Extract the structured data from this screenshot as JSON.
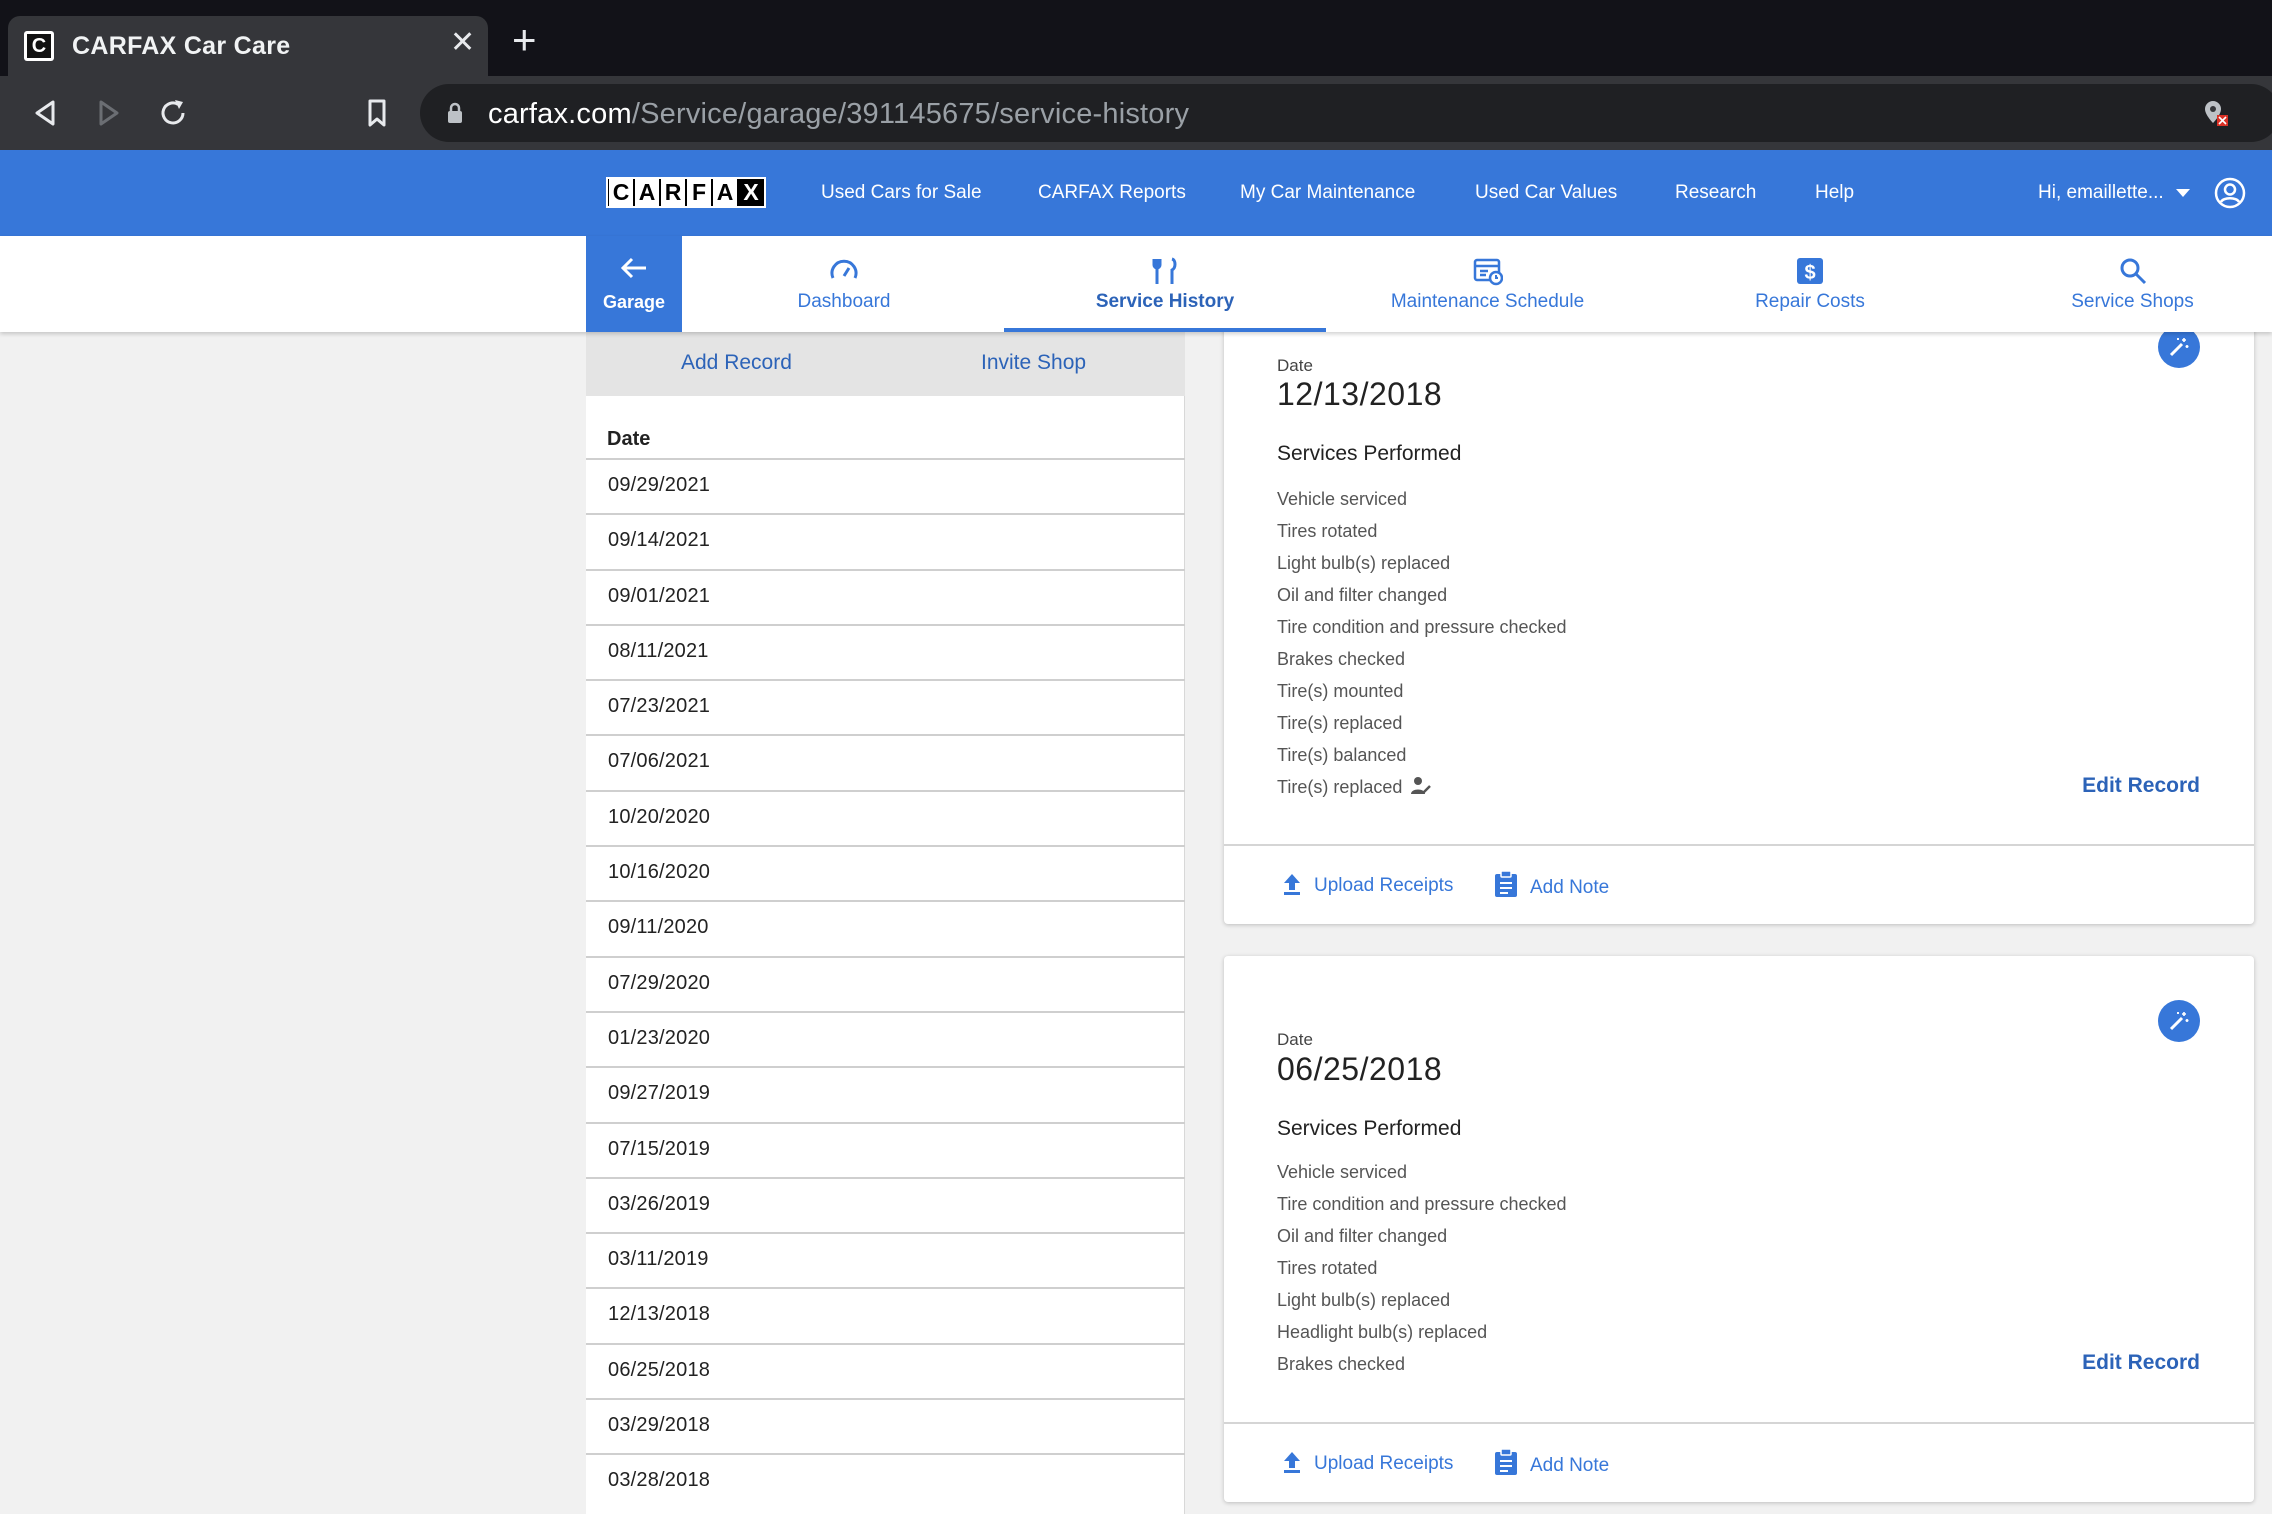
{
  "browser": {
    "tab_title": "CARFAX Car Care",
    "url_domain": "carfax.com",
    "url_path": "/Service/garage/391145675/service-history"
  },
  "logo": {
    "letters": [
      "C",
      "A",
      "R",
      "F",
      "A",
      "X"
    ]
  },
  "header": {
    "nav": [
      "Used Cars for Sale",
      "CARFAX Reports",
      "My Car Maintenance",
      "Used Car Values",
      "Research",
      "Help"
    ],
    "user_greeting": "Hi, emaillette..."
  },
  "subnav": {
    "garage_label": "Garage",
    "tabs": [
      {
        "label": "Dashboard",
        "icon": "speedometer-icon"
      },
      {
        "label": "Service History",
        "icon": "wrench-icon",
        "active": true
      },
      {
        "label": "Maintenance Schedule",
        "icon": "calendar-clock-icon"
      },
      {
        "label": "Repair Costs",
        "icon": "dollar-icon"
      },
      {
        "label": "Service Shops",
        "icon": "search-icon"
      }
    ]
  },
  "list": {
    "add_record": "Add Record",
    "invite_shop": "Invite Shop",
    "column_header": "Date",
    "dates": [
      "09/29/2021",
      "09/14/2021",
      "09/01/2021",
      "08/11/2021",
      "07/23/2021",
      "07/06/2021",
      "10/20/2020",
      "10/16/2020",
      "09/11/2020",
      "07/29/2020",
      "01/23/2020",
      "09/27/2019",
      "07/15/2019",
      "03/26/2019",
      "03/11/2019",
      "12/13/2018",
      "06/25/2018",
      "03/29/2018",
      "03/28/2018"
    ]
  },
  "records": [
    {
      "date_label": "Date",
      "date": "12/13/2018",
      "services_title": "Services Performed",
      "services": [
        "Vehicle serviced",
        "Tires rotated",
        "Light bulb(s) replaced",
        "Oil and filter changed",
        "Tire condition and pressure checked",
        "Brakes checked",
        "Tire(s) mounted",
        "Tire(s) replaced",
        "Tire(s) balanced",
        "Tire(s) replaced"
      ],
      "edit_label": "Edit Record",
      "upload_label": "Upload Receipts",
      "note_label": "Add Note"
    },
    {
      "date_label": "Date",
      "date": "06/25/2018",
      "services_title": "Services Performed",
      "services": [
        "Vehicle serviced",
        "Tire condition and pressure checked",
        "Oil and filter changed",
        "Tires rotated",
        "Light bulb(s) replaced",
        "Headlight bulb(s) replaced",
        "Brakes checked"
      ],
      "edit_label": "Edit Record",
      "upload_label": "Upload Receipts",
      "note_label": "Add Note"
    }
  ],
  "colors": {
    "brand_blue": "#3777d9",
    "link_blue": "#2c63b8"
  }
}
